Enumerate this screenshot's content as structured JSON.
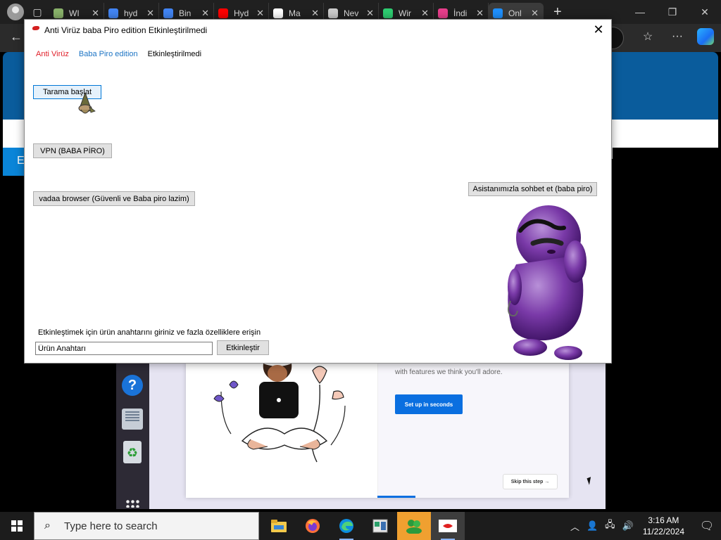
{
  "browser": {
    "tabs": [
      {
        "label": "WI",
        "color": "#8ab36b",
        "active": false
      },
      {
        "label": "hyd",
        "color": "#4285f4",
        "active": false
      },
      {
        "label": "Bin",
        "color": "#4285f4",
        "active": false
      },
      {
        "label": "Hyd",
        "color": "#ff0000",
        "active": false
      },
      {
        "label": "Ma",
        "color": "#ffffff",
        "active": false
      },
      {
        "label": "Nev",
        "color": "#cccccc",
        "active": false
      },
      {
        "label": "Wir",
        "color": "#2ecc71",
        "active": false
      },
      {
        "label": "İndi",
        "color": "#e83e8c",
        "active": false
      },
      {
        "label": "Onl",
        "color": "#1e90ff",
        "active": true
      }
    ],
    "new_tab": "+"
  },
  "dialog": {
    "title": "Anti Virüz baba Piro edition Etkinleştirilmedi",
    "menu": {
      "item1": "Anti Virüz",
      "item2": "Baba Piro edition",
      "item3": "Etkinleştirilmedi"
    },
    "buttons": {
      "scan": "Tarama başlat",
      "vpn": "VPN (BABA PİRO)",
      "browser": "vadaa browser (Güvenli ve Baba piro lazim)",
      "chat": "Asistanımızla sohbet et (baba piro)",
      "activate": "Etkinleştir"
    },
    "activation_label": "Etkinleştimek için ürün anahtarını giriniz ve fazla özelliklere erişin",
    "product_key_value": "Ürün Anahtarı",
    "colors": {
      "menu_red": "#e0202a",
      "menu_blue": "#1c74c4"
    }
  },
  "background_page": {
    "left_letter": "E",
    "card_text": "with features we think you'll adore.",
    "setup_button": "Set up in seconds",
    "skip_button": "Skip this step →"
  },
  "taskbar": {
    "search_placeholder": "Type here to search",
    "time": "3:16 AM",
    "date": "11/22/2024"
  }
}
